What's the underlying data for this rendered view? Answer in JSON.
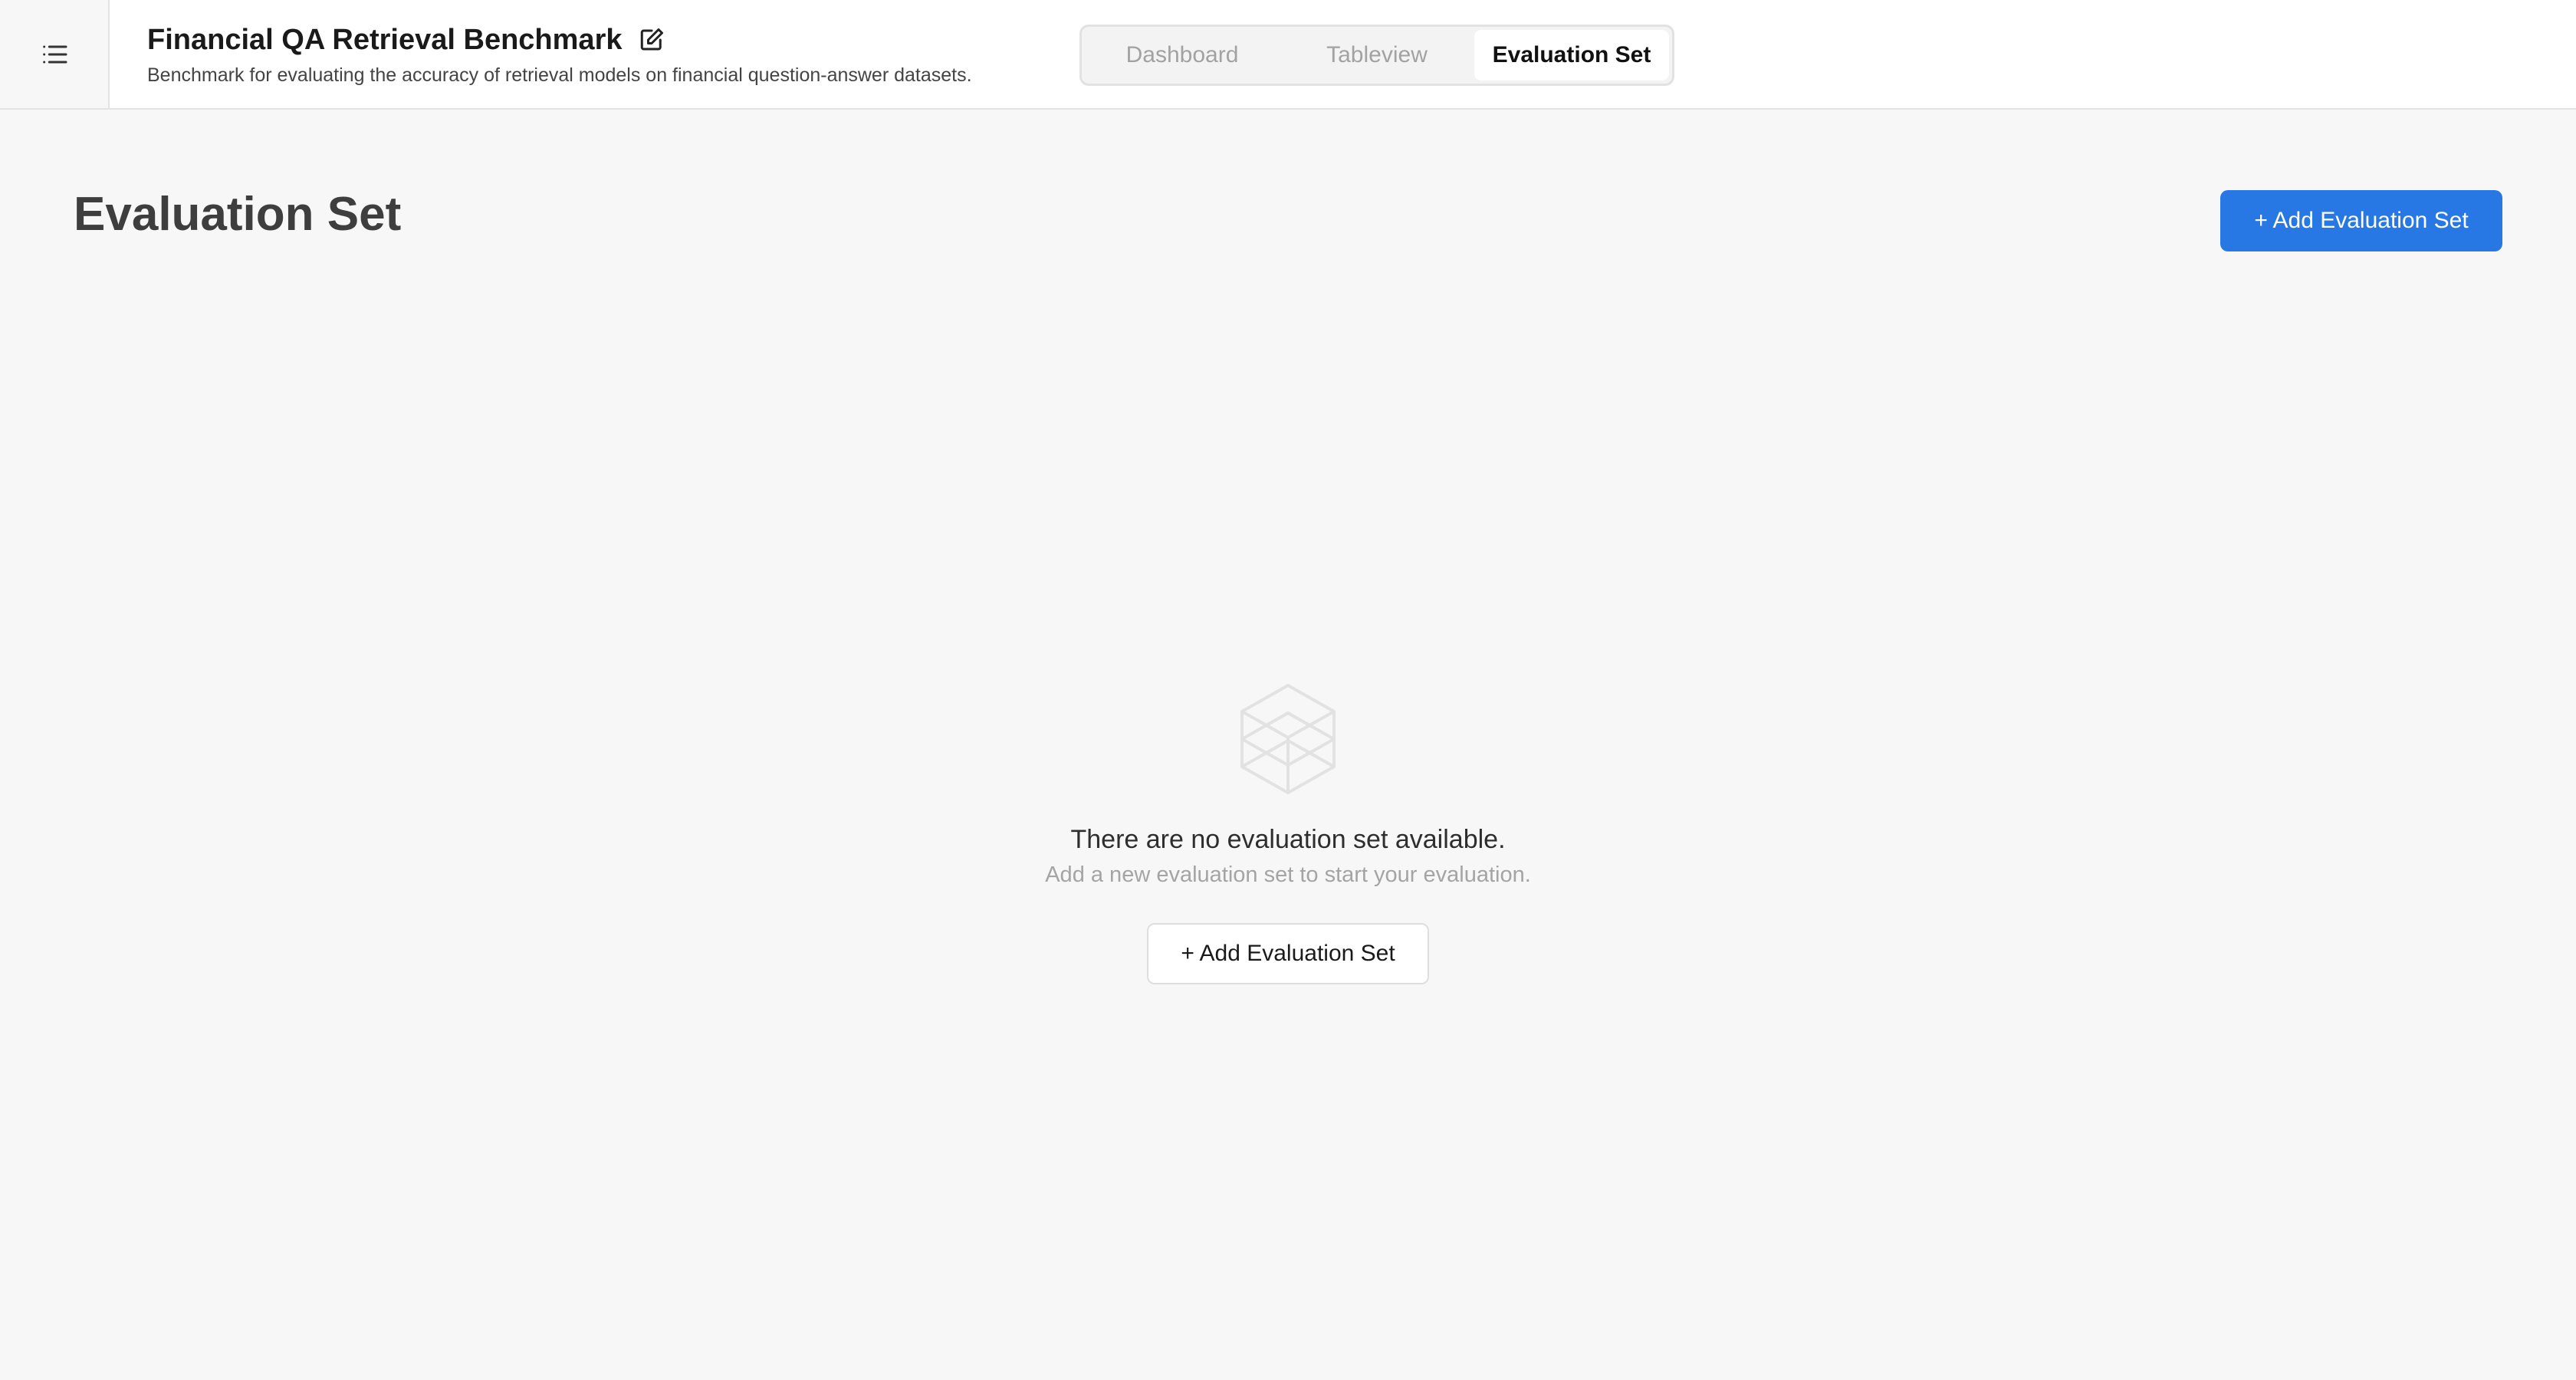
{
  "header": {
    "menu_icon": "list-icon",
    "title": "Financial QA Retrieval Benchmark",
    "edit_icon": "edit-icon",
    "subtitle": "Benchmark for evaluating the accuracy of retrieval models on financial question-answer datasets."
  },
  "tabs": [
    {
      "label": "Dashboard",
      "active": false
    },
    {
      "label": "Tableview",
      "active": false
    },
    {
      "label": "Evaluation Set",
      "active": true
    }
  ],
  "main": {
    "title": "Evaluation Set",
    "add_button_label": "+ Add Evaluation Set"
  },
  "empty_state": {
    "icon": "layers-icon",
    "title": "There are no evaluation set available.",
    "subtitle": "Add a new evaluation set to start your evaluation.",
    "button_label": "+ Add Evaluation Set"
  },
  "colors": {
    "accent": "#2778e4",
    "background": "#f7f7f7"
  }
}
